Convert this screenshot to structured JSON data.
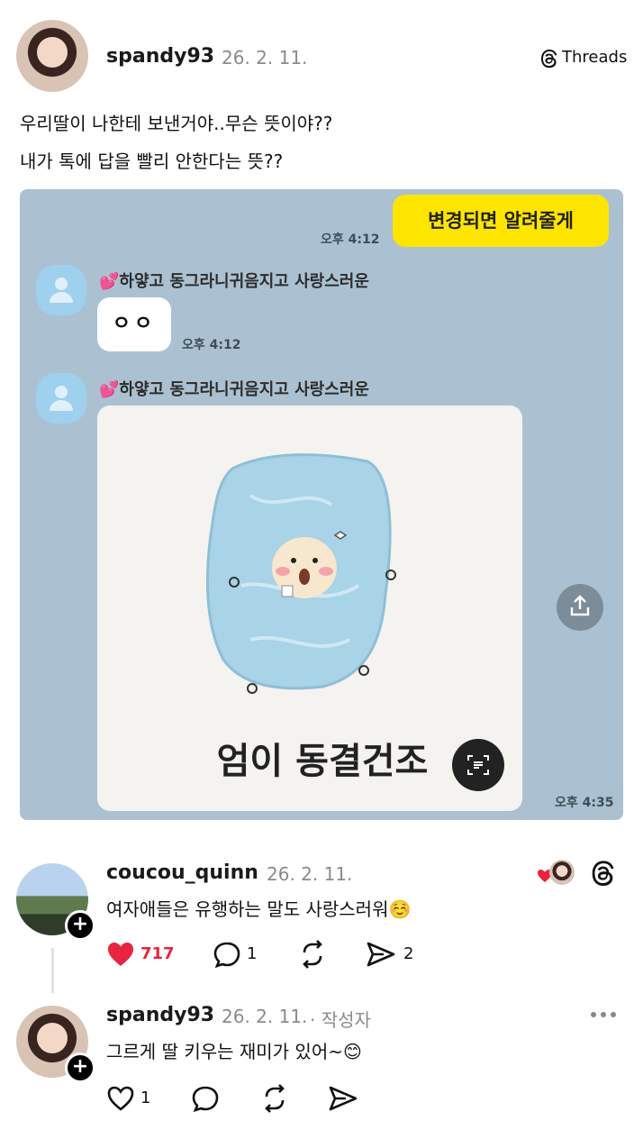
{
  "post": {
    "username": "spandy93",
    "date": "26. 2. 11.",
    "brand": "Threads",
    "text_line1": "우리딸이 나한테 보낸거야..무슨 뜻이야??",
    "text_line2": "내가 톡에 답을 빨리 안한다는 뜻??"
  },
  "chat": {
    "my_message": "변경되면 알려줄게",
    "my_message_time": "오후 4:12",
    "sender_name": "💕하얗고 동그라니귀음지고 사랑스러운",
    "reply_text": "ㅇㅇ",
    "reply_time": "오후 4:12",
    "image_caption": "엄이 동결건조",
    "image_time": "오후 4:35"
  },
  "reply1": {
    "username": "coucou_quinn",
    "date": "26. 2. 11.",
    "text": "여자애들은 유행하는 말도 사랑스러워☺️",
    "likes": "717",
    "comments": "1",
    "shares": "2"
  },
  "reply2": {
    "username": "spandy93",
    "date": "26. 2. 11.",
    "author_tag": "· 작성자",
    "text": "그르게 딸 키우는 재미가 있어~😊",
    "likes": "1"
  },
  "colors": {
    "heart": "#e8243f",
    "kakao_yellow": "#fee500",
    "chat_bg": "#abc1d1"
  }
}
